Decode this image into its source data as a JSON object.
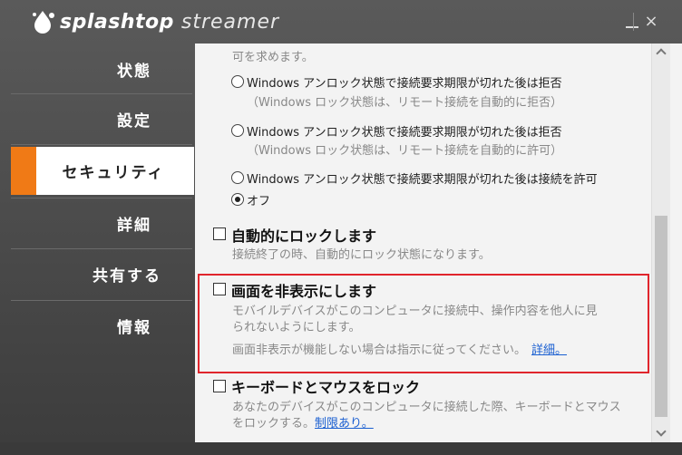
{
  "app": {
    "brand_bold": "splashtop",
    "brand_light": "streamer",
    "minimize_label": "",
    "close_label": "×"
  },
  "sidebar": {
    "items": [
      {
        "label": "状態"
      },
      {
        "label": "設定"
      },
      {
        "label": "セキュリティ"
      },
      {
        "label": "詳細"
      },
      {
        "label": "共有する"
      },
      {
        "label": "情報"
      }
    ],
    "selected_index": 2,
    "accent_color": "#f07a16"
  },
  "content": {
    "top_cutoff": "可を求めます。",
    "options": [
      {
        "label": "Windows アンロック状態で接続要求期限が切れた後は拒否",
        "sub": "（Windows ロック状態は、リモート接続を自動的に拒否）",
        "selected": false
      },
      {
        "label": "Windows アンロック状態で接続要求期限が切れた後は拒否",
        "sub": "（Windows ロック状態は、リモート接続を自動的に許可）",
        "selected": false
      },
      {
        "label": "Windows アンロック状態で接続要求期限が切れた後は接続を許可",
        "sub": "",
        "selected": false
      },
      {
        "label": "オフ",
        "sub": "",
        "selected": true
      }
    ],
    "auto_lock": {
      "title": "自動的にロックします",
      "desc": "接続終了の時、自動的にロック状態になります。",
      "checked": false
    },
    "blank_screen": {
      "title": "画面を非表示にします",
      "desc_line1": "モバイルデバイスがこのコンピュータに接続中、操作内容を他人に見",
      "desc_line2": "られないようにします。",
      "note": "画面非表示が機能しない場合は指示に従ってください。",
      "link": "詳細。",
      "checked": false,
      "highlight_color": "#e0252c"
    },
    "lock_input": {
      "title": "キーボードとマウスをロック",
      "desc_line1": "あなたのデバイスがこのコンピュータに接続した際、キーボードとマウス",
      "desc_line2_prefix": "をロックする。",
      "link": "制限あり。",
      "checked": false
    }
  }
}
